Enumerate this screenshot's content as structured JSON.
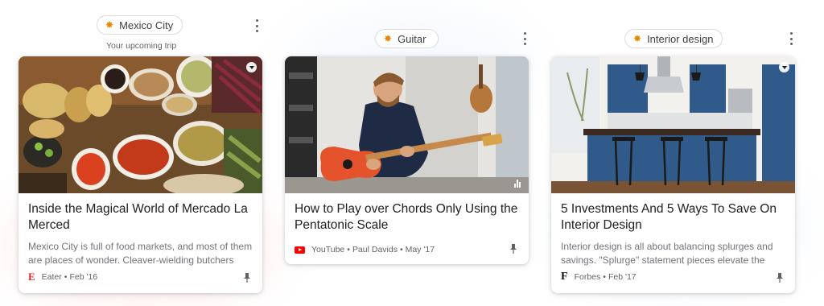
{
  "columns": [
    {
      "topic": "Mexico City",
      "subtitle": "Your upcoming trip",
      "card": {
        "title": "Inside the Magical World of Mercado La Merced",
        "snippet": "Mexico City is full of food markets, and most of them are places of wonder. Cleaver-wielding butchers ja…",
        "source": "Eater",
        "date": "Feb '16",
        "logo": "E"
      }
    },
    {
      "topic": "Guitar",
      "card": {
        "title": "How to Play over Chords Only Using the Pentatonic Scale",
        "source": "YouTube",
        "author": "Paul Davids",
        "date": "May '17"
      }
    },
    {
      "topic": "Interior design",
      "card": {
        "title": "5 Investments And 5 Ways To Save On Interior Design",
        "snippet": "Interior design is all about balancing splurges and savings. \"Splurge\" statement pieces elevate the loo…",
        "source": "Forbes",
        "date": "Feb '17",
        "logo": "F"
      }
    }
  ],
  "separator": "•",
  "topic_icon": "sparkle-icon",
  "colors": {
    "chip_star": "#ea8600",
    "eater_red": "#e4202c",
    "youtube_red": "#ff0000",
    "cabinet_blue": "#2f5a8a"
  }
}
